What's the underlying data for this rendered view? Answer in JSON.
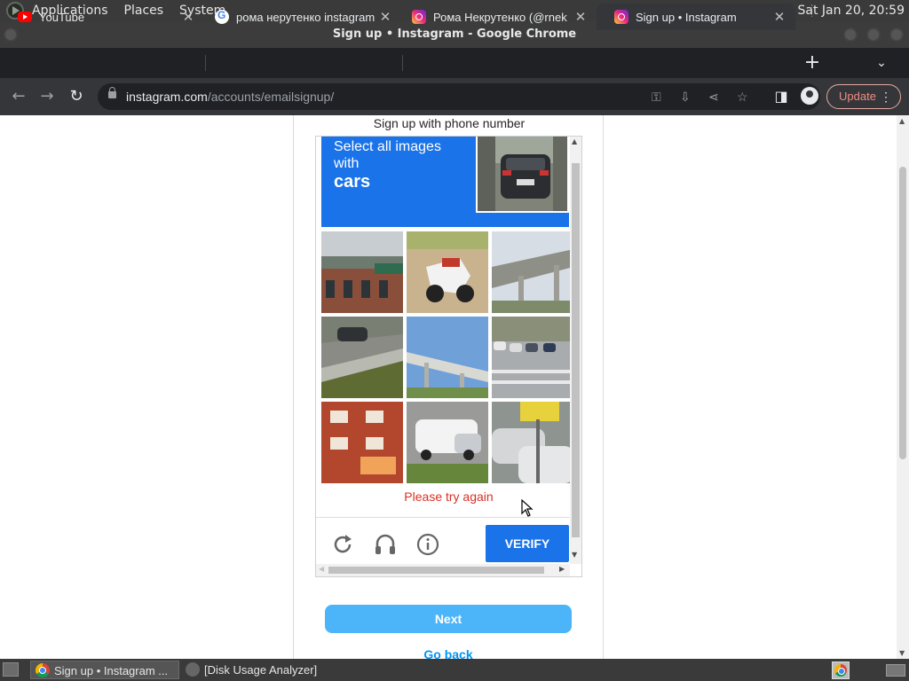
{
  "top_panel": {
    "menus": [
      "Applications",
      "Places",
      "System"
    ],
    "clock": "Sat Jan 20, 20:59"
  },
  "window": {
    "title": "Sign up • Instagram - Google Chrome"
  },
  "tabs": [
    {
      "title": "YouTube",
      "favicon": "youtube-icon"
    },
    {
      "title": "рома нерутенко instagram",
      "favicon": "google-icon"
    },
    {
      "title": "Рома Некрутенко (@rnek",
      "favicon": "instagram-icon"
    },
    {
      "title": "Sign up • Instagram",
      "favicon": "instagram-icon",
      "active": true
    }
  ],
  "toolbar": {
    "url_domain": "instagram.com",
    "url_path": "/accounts/emailsignup/",
    "update_label": "Update"
  },
  "page": {
    "signup_phone_link": "Sign up with phone number",
    "next_label": "Next",
    "go_back_label": "Go back"
  },
  "captcha": {
    "instruction": "Select all images with",
    "target": "cars",
    "error": "Please try again",
    "verify_label": "VERIFY",
    "tiles": [
      "building-with-awning",
      "white-scooter",
      "highway-overpass",
      "car-on-road-guardrail",
      "elevated-highway",
      "parked-cars-lot",
      "red-apartment-building",
      "white-van-street",
      "cars-with-sign"
    ]
  },
  "taskbar": {
    "tasks": [
      "Sign up • Instagram ...",
      "[Disk Usage Analyzer]"
    ]
  },
  "colors": {
    "captcha_blue": "#1a73e8",
    "error_red": "#d93025",
    "next_button": "#4cb5f9",
    "link_blue": "#0095f6"
  }
}
